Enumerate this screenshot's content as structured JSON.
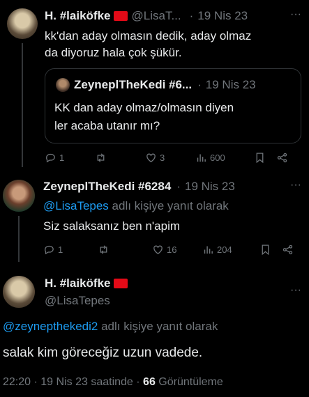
{
  "colors": {
    "background": "#000000",
    "text": "#e7e9ea",
    "muted": "#71767b",
    "link": "#1d9bf0",
    "flag": "#e30a17"
  },
  "tweet1": {
    "name": "H. #laiköfke",
    "handle": "@LisaT...",
    "sep": "·",
    "date": "19 Nis 23",
    "text_line1": "kk'dan aday olmasın dedik, aday olmaz",
    "text_line2": "da diyoruz hala çok şükür.",
    "quote": {
      "name": "ZeyneplTheKedi #6...",
      "sep": "·",
      "date": "19 Nis 23",
      "text_line1": "KK dan aday olmaz/olmasın diyen",
      "text_line2": "ler acaba utanır mı?"
    },
    "actions": {
      "reply": "1",
      "retweet": "",
      "like": "3",
      "views": "600"
    }
  },
  "tweet2": {
    "name": "ZeyneplTheKedi #6284",
    "sep": "·",
    "date": "19 Nis 23",
    "reply_to_handle": "@LisaTepes",
    "reply_to_suffix": "adlı kişiye yanıt olarak",
    "text": "Siz salaksanız ben n'apim",
    "actions": {
      "reply": "1",
      "retweet": "",
      "like": "16",
      "views": "204"
    }
  },
  "tweet3": {
    "name": "H. #laiköfke",
    "handle": "@LisaTepes",
    "reply_to_handle": "@zeynepthekedi2",
    "reply_to_suffix": "adlı kişiye yanıt olarak",
    "text": "salak kim göreceğiz uzun vadede.",
    "time": "22:20",
    "sep1": "·",
    "date": "19 Nis 23 saatinde",
    "sep2": "·",
    "views_count": "66",
    "views_label": "Görüntüleme"
  }
}
